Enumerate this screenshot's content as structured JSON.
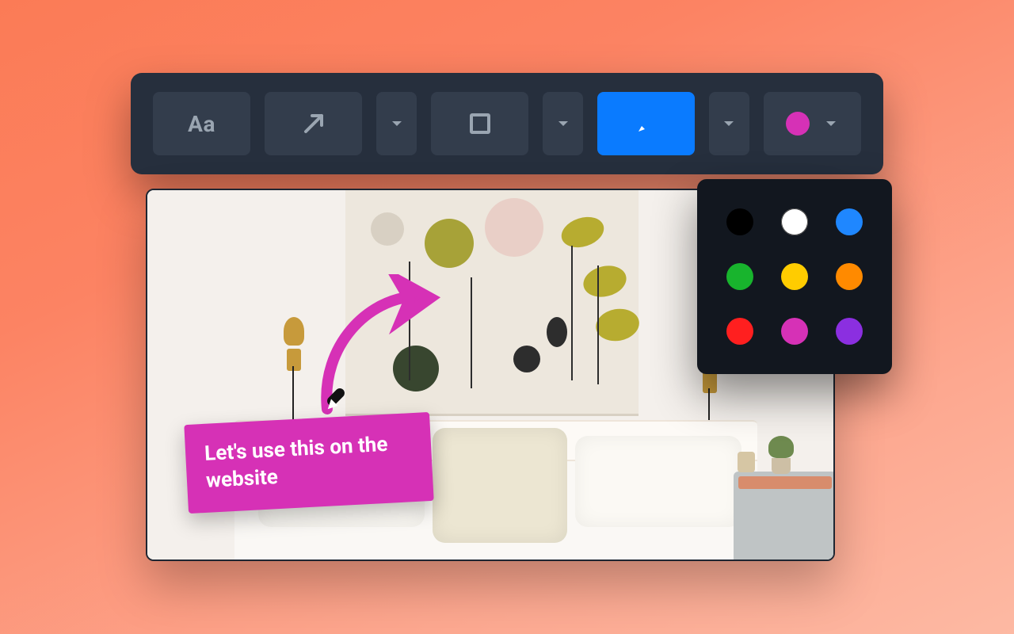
{
  "toolbar": {
    "tools": [
      {
        "id": "text",
        "icon": "text-icon",
        "has_dropdown": false
      },
      {
        "id": "arrow",
        "icon": "arrow-icon",
        "has_dropdown": true
      },
      {
        "id": "shape",
        "icon": "rectangle-icon",
        "has_dropdown": true
      },
      {
        "id": "pen",
        "icon": "pen-icon",
        "has_dropdown": true,
        "active": true
      }
    ],
    "text_label": "Aa",
    "current_color": "#d631b6"
  },
  "color_picker": {
    "open": true,
    "colors": [
      "#000000",
      "#ffffff",
      "#1f87ff",
      "#18b42d",
      "#ffcc00",
      "#ff8a00",
      "#ff1f1f",
      "#d631b6",
      "#8b2fe0"
    ],
    "selected": "#d631b6"
  },
  "annotation": {
    "label_text": "Let's use this on the website",
    "label_color": "#d631b6",
    "arrow_color": "#d631b6"
  }
}
